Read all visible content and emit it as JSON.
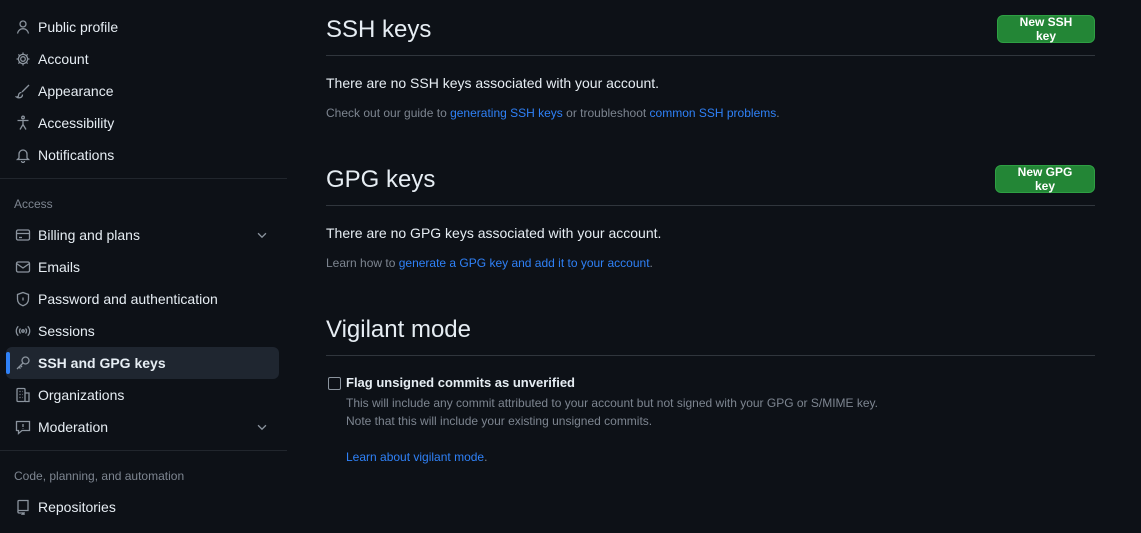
{
  "sidebar": {
    "items_top": [
      {
        "label": "Public profile",
        "icon": "person-icon"
      },
      {
        "label": "Account",
        "icon": "gear-icon"
      },
      {
        "label": "Appearance",
        "icon": "paintbrush-icon"
      },
      {
        "label": "Accessibility",
        "icon": "accessibility-icon"
      },
      {
        "label": "Notifications",
        "icon": "bell-icon"
      }
    ],
    "access_label": "Access",
    "items_access": [
      {
        "label": "Billing and plans",
        "icon": "credit-card-icon"
      },
      {
        "label": "Emails",
        "icon": "mail-icon"
      },
      {
        "label": "Password and authentication",
        "icon": "shield-lock-icon"
      },
      {
        "label": "Sessions",
        "icon": "broadcast-icon"
      },
      {
        "label": "SSH and GPG keys",
        "icon": "key-icon"
      },
      {
        "label": "Organizations",
        "icon": "organization-icon"
      },
      {
        "label": "Moderation",
        "icon": "report-icon"
      }
    ],
    "code_label": "Code, planning, and automation",
    "items_code": [
      {
        "label": "Repositories",
        "icon": "repo-icon"
      }
    ]
  },
  "ssh": {
    "title": "SSH keys",
    "button": "New SSH key",
    "empty": "There are no SSH keys associated with your account.",
    "hint_prefix": "Check out our guide to ",
    "hint_link1": "generating SSH keys",
    "hint_mid": " or troubleshoot ",
    "hint_link2": "common SSH problems",
    "hint_suffix": "."
  },
  "gpg": {
    "title": "GPG keys",
    "button": "New GPG key",
    "empty": "There are no GPG keys associated with your account.",
    "hint_prefix": "Learn how to ",
    "hint_link": "generate a GPG key and add it to your account",
    "hint_suffix": "."
  },
  "vigilant": {
    "title": "Vigilant mode",
    "checkbox_label": "Flag unsigned commits as unverified",
    "checked": false,
    "note1": "This will include any commit attributed to your account but not signed with your GPG or S/MIME key.",
    "note2": "Note that this will include your existing unsigned commits.",
    "learn_link": "Learn about vigilant mode",
    "learn_suffix": "."
  },
  "colors": {
    "background": "#0d1117",
    "accent": "#2f81f7",
    "button_green": "#238636",
    "muted": "#7d8590"
  }
}
